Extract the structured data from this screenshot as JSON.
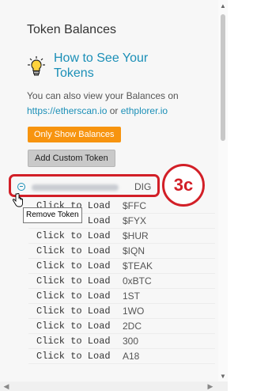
{
  "panel": {
    "title": "Token Balances",
    "help_title": "How to See Your Tokens",
    "desc_prefix": "You can also view your Balances on",
    "link1": "https://etherscan.io",
    "desc_or": " or ",
    "link2": "ethplorer.io",
    "btn_only": "Only Show Balances",
    "btn_add": "Add Custom Token"
  },
  "first_token": {
    "symbol": "DIG"
  },
  "annotation": {
    "badge": "3c",
    "tooltip": "Remove Token"
  },
  "tokens": [
    {
      "load": "Click to Load",
      "symbol": "$FFC"
    },
    {
      "load": "Click to Load",
      "symbol": "$FYX"
    },
    {
      "load": "Click to Load",
      "symbol": "$HUR"
    },
    {
      "load": "Click to Load",
      "symbol": "$IQN"
    },
    {
      "load": "Click to Load",
      "symbol": "$TEAK"
    },
    {
      "load": "Click to Load",
      "symbol": "0xBTC"
    },
    {
      "load": "Click to Load",
      "symbol": "1ST"
    },
    {
      "load": "Click to Load",
      "symbol": "1WO"
    },
    {
      "load": "Click to Load",
      "symbol": "2DC"
    },
    {
      "load": "Click to Load",
      "symbol": "300"
    },
    {
      "load": "Click to Load",
      "symbol": "A18"
    }
  ],
  "icons": {
    "bulb": "lightbulb-icon",
    "remove": "minus-circle-icon",
    "cursor": "hand-pointer-icon"
  },
  "colors": {
    "accent": "#1b8fb7",
    "orange": "#f7940f",
    "annotation": "#d21f27"
  }
}
